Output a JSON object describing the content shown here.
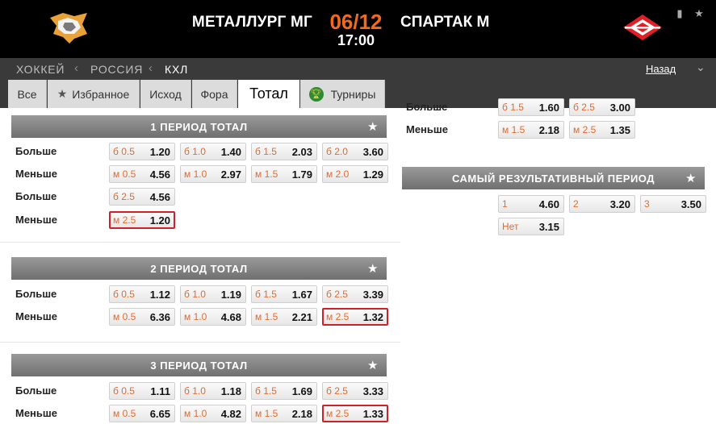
{
  "header": {
    "team_home": "МЕТАЛЛУРГ МГ",
    "team_away": "СПАРТАК М",
    "date": "06/12",
    "time": "17:00",
    "date_color": "#f26b1d",
    "icons": [
      "stats-icon",
      "star-icon"
    ]
  },
  "breadcrumb": {
    "items": [
      "ХОККЕЙ",
      "РОССИЯ",
      "КХЛ"
    ],
    "back_label": "Назад"
  },
  "tabs": [
    {
      "label": "Все",
      "icon": ""
    },
    {
      "label": "Избранное",
      "icon": "star-icon"
    },
    {
      "label": "Исход",
      "icon": ""
    },
    {
      "label": "Фора",
      "icon": ""
    },
    {
      "label": "Тотал",
      "icon": "",
      "active": true
    },
    {
      "label": "Турниры",
      "icon": "trophy-icon"
    }
  ],
  "accent": "#d0202a",
  "sections": {
    "p1": {
      "title": "1 ПЕРИОД ТОТАЛ",
      "rows": [
        {
          "label": "Больше",
          "odds": [
            {
              "line": "б 0.5",
              "value": "1.20"
            },
            {
              "line": "б 1.0",
              "value": "1.40"
            },
            {
              "line": "б 1.5",
              "value": "2.03"
            },
            {
              "line": "б 2.0",
              "value": "3.60"
            }
          ]
        },
        {
          "label": "Меньше",
          "odds": [
            {
              "line": "м 0.5",
              "value": "4.56"
            },
            {
              "line": "м 1.0",
              "value": "2.97"
            },
            {
              "line": "м 1.5",
              "value": "1.79"
            },
            {
              "line": "м 2.0",
              "value": "1.29"
            }
          ]
        },
        {
          "label": "Больше",
          "odds": [
            {
              "line": "б 2.5",
              "value": "4.56"
            }
          ]
        },
        {
          "label": "Меньше",
          "odds": [
            {
              "line": "м 2.5",
              "value": "1.20",
              "highlighted": true
            }
          ]
        }
      ]
    },
    "p2": {
      "title": "2 ПЕРИОД ТОТАЛ",
      "rows": [
        {
          "label": "Больше",
          "odds": [
            {
              "line": "б 0.5",
              "value": "1.12"
            },
            {
              "line": "б 1.0",
              "value": "1.19"
            },
            {
              "line": "б 1.5",
              "value": "1.67"
            },
            {
              "line": "б 2.5",
              "value": "3.39"
            }
          ]
        },
        {
          "label": "Меньше",
          "odds": [
            {
              "line": "м 0.5",
              "value": "6.36"
            },
            {
              "line": "м 1.0",
              "value": "4.68"
            },
            {
              "line": "м 1.5",
              "value": "2.21"
            },
            {
              "line": "м 2.5",
              "value": "1.32",
              "highlighted": true
            }
          ]
        }
      ]
    },
    "p3": {
      "title": "3 ПЕРИОД ТОТАЛ",
      "rows": [
        {
          "label": "Больше",
          "odds": [
            {
              "line": "б 0.5",
              "value": "1.11"
            },
            {
              "line": "б 1.0",
              "value": "1.18"
            },
            {
              "line": "б 1.5",
              "value": "1.69"
            },
            {
              "line": "б 2.5",
              "value": "3.33"
            }
          ]
        },
        {
          "label": "Меньше",
          "odds": [
            {
              "line": "м 0.5",
              "value": "6.65"
            },
            {
              "line": "м 1.0",
              "value": "4.82"
            },
            {
              "line": "м 1.5",
              "value": "2.18"
            },
            {
              "line": "м 2.5",
              "value": "1.33",
              "highlighted": true
            }
          ]
        }
      ]
    },
    "right_top": {
      "rows": [
        {
          "label": "Больше",
          "odds": [
            {
              "line": "б 1.5",
              "value": "1.60"
            },
            {
              "line": "б 2.5",
              "value": "3.00"
            }
          ]
        },
        {
          "label": "Меньше",
          "odds": [
            {
              "line": "м 1.5",
              "value": "2.18"
            },
            {
              "line": "м 2.5",
              "value": "1.35"
            }
          ]
        }
      ]
    },
    "top_period": {
      "title": "САМЫЙ РЕЗУЛЬТАТИВНЫЙ ПЕРИОД",
      "odds": [
        {
          "line": "1",
          "value": "4.60"
        },
        {
          "line": "2",
          "value": "3.20"
        },
        {
          "line": "3",
          "value": "3.50"
        },
        {
          "line": "Нет",
          "value": "3.15"
        }
      ]
    }
  }
}
